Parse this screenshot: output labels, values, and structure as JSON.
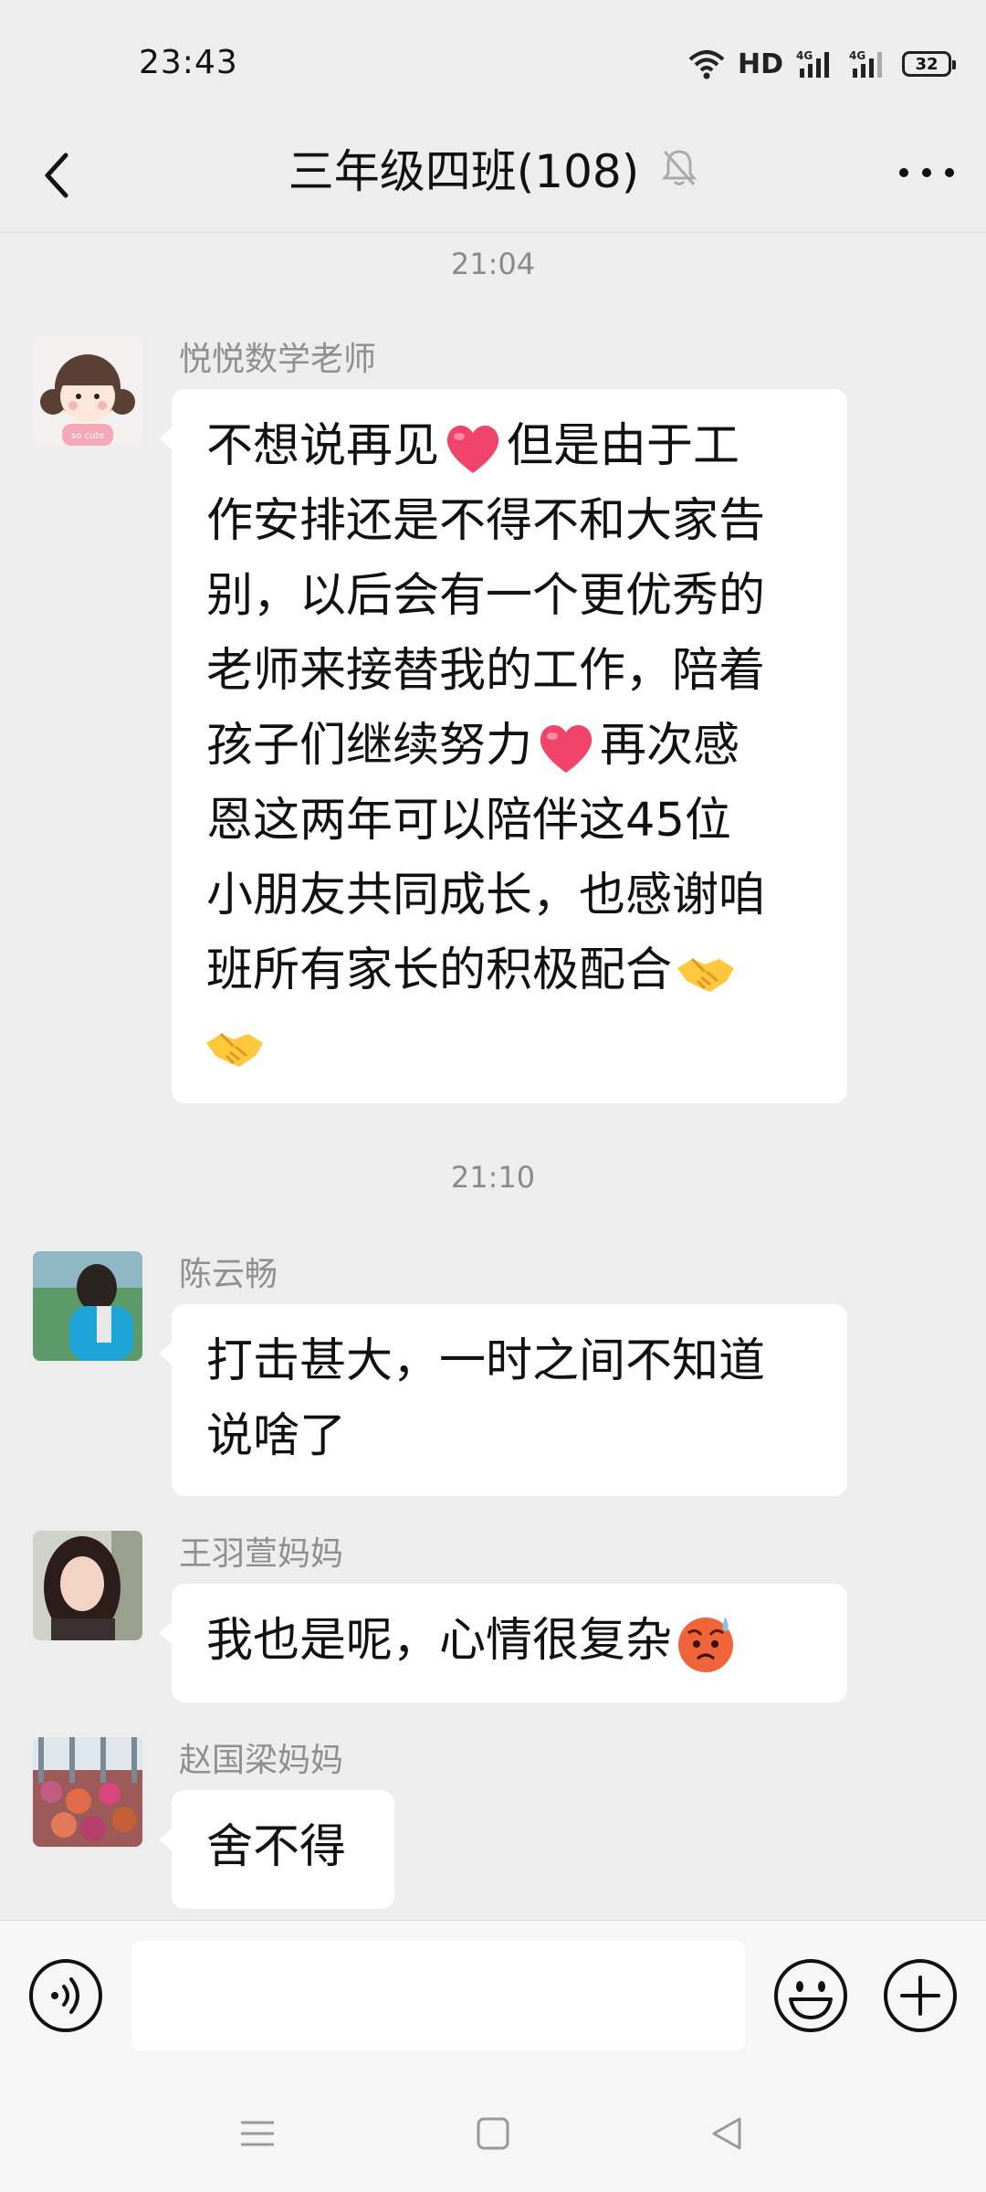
{
  "status_bar": {
    "time": "23:43",
    "network_label": "HD",
    "signal_label_1": "4G",
    "signal_label_2": "4G",
    "battery": "32"
  },
  "header": {
    "title": "三年级四班(108)",
    "muted": true
  },
  "chat": {
    "timestamps": [
      "21:04",
      "21:10"
    ],
    "messages": [
      {
        "sender": "悦悦数学老师",
        "lines": [
          "不想说再见",
          "但是由于工",
          "作安排还是不得不和大家告",
          "别，以后会有一个更优秀的",
          "老师来接替我的工作，陪着",
          "孩子们继续努力",
          "再次感",
          "恩这两年可以陪伴这45位",
          "小朋友共同成长，也感谢咱",
          "班所有家长的积极配合"
        ],
        "emojis": [
          "heart",
          "heart",
          "handshake",
          "handshake"
        ]
      },
      {
        "sender": "陈云畅",
        "lines": [
          "打击甚大，一时之间不知道",
          "说啥了"
        ]
      },
      {
        "sender": "王羽萱妈妈",
        "text": "我也是呢，心情很复杂",
        "emoji": "anxious-sweat-face"
      },
      {
        "sender": "赵国梁妈妈",
        "text": "舍不得"
      }
    ]
  },
  "input": {
    "placeholder": "",
    "value": ""
  },
  "colors": {
    "background": "#ededed",
    "bubble": "#ffffff",
    "meta_text": "#8a8a8a",
    "heart": "#f0446a"
  }
}
